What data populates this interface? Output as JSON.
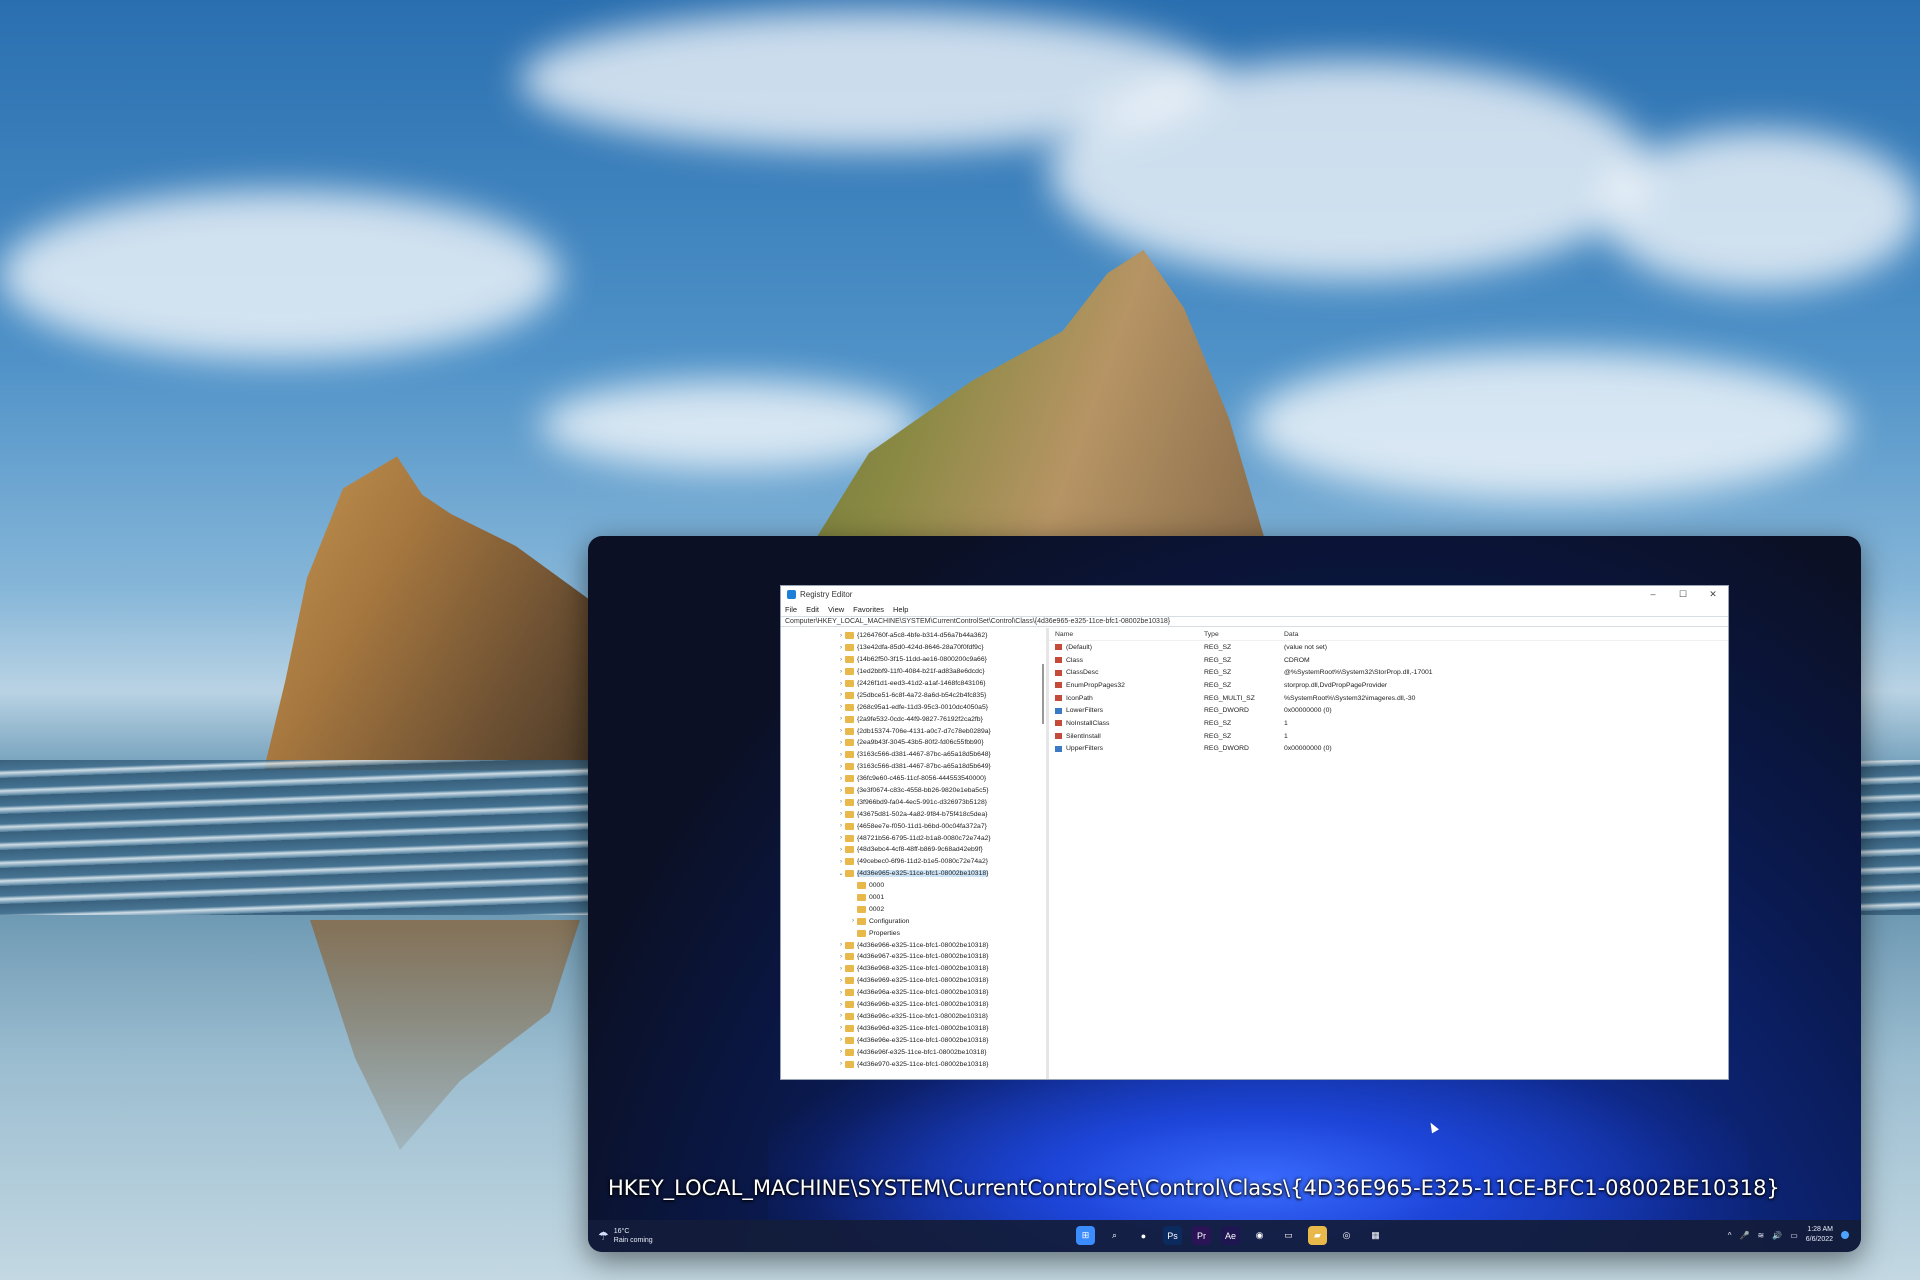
{
  "regedit": {
    "title": "Registry Editor",
    "controls": {
      "minimize": "–",
      "maximize": "☐",
      "close": "✕"
    },
    "menu": [
      "File",
      "Edit",
      "View",
      "Favorites",
      "Help"
    ],
    "address": "Computer\\HKEY_LOCAL_MACHINE\\SYSTEM\\CurrentControlSet\\Control\\Class\\{4d36e965-e325-11ce-bfc1-08002be10318}",
    "tree": [
      {
        "label": "{1264760f-a5c8-4bfe-b314-d56a7b44a362}",
        "level": 0,
        "expanded": false,
        "selected": false
      },
      {
        "label": "{13e42dfa-85d0-424d-8646-28a70f0fdf9c}",
        "level": 0,
        "expanded": false,
        "selected": false
      },
      {
        "label": "{14b62f50-3f15-11dd-ae16-0800200c9a66}",
        "level": 0,
        "expanded": false,
        "selected": false
      },
      {
        "label": "{1ed2bbf9-11f0-4084-b21f-ad83a8e6dcdc}",
        "level": 0,
        "expanded": false,
        "selected": false
      },
      {
        "label": "{2426f1d1-eed3-41d2-a1af-1468fc843106}",
        "level": 0,
        "expanded": false,
        "selected": false
      },
      {
        "label": "{25dbce51-6c8f-4a72-8a6d-b54c2b4fc835}",
        "level": 0,
        "expanded": false,
        "selected": false
      },
      {
        "label": "{268c95a1-edfe-11d3-95c3-0010dc4050a5}",
        "level": 0,
        "expanded": false,
        "selected": false
      },
      {
        "label": "{2a9fe532-0cdc-44f9-9827-76192f2ca2fb}",
        "level": 0,
        "expanded": false,
        "selected": false
      },
      {
        "label": "{2db15374-706e-4131-a0c7-d7c78eb0289a}",
        "level": 0,
        "expanded": false,
        "selected": false
      },
      {
        "label": "{2ea9b43f-3045-43b5-80f2-fd06c55fbb90}",
        "level": 0,
        "expanded": false,
        "selected": false
      },
      {
        "label": "{3163c566-d381-4467-87bc-a65a18d5b648}",
        "level": 0,
        "expanded": false,
        "selected": false
      },
      {
        "label": "{3163c566-d381-4467-87bc-a65a18d5b649}",
        "level": 0,
        "expanded": false,
        "selected": false
      },
      {
        "label": "{36fc9e60-c465-11cf-8056-444553540000}",
        "level": 0,
        "expanded": false,
        "selected": false
      },
      {
        "label": "{3e3f0674-c83c-4558-bb26-9820e1eba5c5}",
        "level": 0,
        "expanded": false,
        "selected": false
      },
      {
        "label": "{3f966bd9-fa04-4ec5-991c-d326973b5128}",
        "level": 0,
        "expanded": false,
        "selected": false
      },
      {
        "label": "{43675d81-502a-4a82-9f84-b75f418c5dea}",
        "level": 0,
        "expanded": false,
        "selected": false
      },
      {
        "label": "{4658ee7e-f050-11d1-b6bd-00c04fa372a7}",
        "level": 0,
        "expanded": false,
        "selected": false
      },
      {
        "label": "{48721b56-6795-11d2-b1a8-0080c72e74a2}",
        "level": 0,
        "expanded": false,
        "selected": false
      },
      {
        "label": "{48d3ebc4-4cf8-48ff-b869-9c68ad42eb9f}",
        "level": 0,
        "expanded": false,
        "selected": false
      },
      {
        "label": "{49cebec0-6f96-11d2-b1e5-0080c72e74a2}",
        "level": 0,
        "expanded": false,
        "selected": false
      },
      {
        "label": "{4d36e965-e325-11ce-bfc1-08002be10318}",
        "level": 0,
        "expanded": true,
        "selected": true
      },
      {
        "label": "0000",
        "level": 1,
        "expanded": false,
        "selected": false
      },
      {
        "label": "0001",
        "level": 1,
        "expanded": false,
        "selected": false
      },
      {
        "label": "0002",
        "level": 1,
        "expanded": false,
        "selected": false
      },
      {
        "label": "Configuration",
        "level": 1,
        "expanded": false,
        "selected": false
      },
      {
        "label": "Properties",
        "level": 1,
        "expanded": false,
        "selected": false
      },
      {
        "label": "{4d36e966-e325-11ce-bfc1-08002be10318}",
        "level": 0,
        "expanded": false,
        "selected": false
      },
      {
        "label": "{4d36e967-e325-11ce-bfc1-08002be10318}",
        "level": 0,
        "expanded": false,
        "selected": false
      },
      {
        "label": "{4d36e968-e325-11ce-bfc1-08002be10318}",
        "level": 0,
        "expanded": false,
        "selected": false
      },
      {
        "label": "{4d36e969-e325-11ce-bfc1-08002be10318}",
        "level": 0,
        "expanded": false,
        "selected": false
      },
      {
        "label": "{4d36e96a-e325-11ce-bfc1-08002be10318}",
        "level": 0,
        "expanded": false,
        "selected": false
      },
      {
        "label": "{4d36e96b-e325-11ce-bfc1-08002be10318}",
        "level": 0,
        "expanded": false,
        "selected": false
      },
      {
        "label": "{4d36e96c-e325-11ce-bfc1-08002be10318}",
        "level": 0,
        "expanded": false,
        "selected": false
      },
      {
        "label": "{4d36e96d-e325-11ce-bfc1-08002be10318}",
        "level": 0,
        "expanded": false,
        "selected": false
      },
      {
        "label": "{4d36e96e-e325-11ce-bfc1-08002be10318}",
        "level": 0,
        "expanded": false,
        "selected": false
      },
      {
        "label": "{4d36e96f-e325-11ce-bfc1-08002be10318}",
        "level": 0,
        "expanded": false,
        "selected": false
      },
      {
        "label": "{4d36e970-e325-11ce-bfc1-08002be10318}",
        "level": 0,
        "expanded": false,
        "selected": false
      }
    ],
    "columns": {
      "name": "Name",
      "type": "Type",
      "data": "Data"
    },
    "values": [
      {
        "name": "(Default)",
        "type": "REG_SZ",
        "data": "(value not set)",
        "kind": "ab"
      },
      {
        "name": "Class",
        "type": "REG_SZ",
        "data": "CDROM",
        "kind": "ab"
      },
      {
        "name": "ClassDesc",
        "type": "REG_SZ",
        "data": "@%SystemRoot%\\System32\\StorProp.dll,-17001",
        "kind": "ab"
      },
      {
        "name": "EnumPropPages32",
        "type": "REG_SZ",
        "data": "storprop.dll,DvdPropPageProvider",
        "kind": "ab"
      },
      {
        "name": "IconPath",
        "type": "REG_MULTI_SZ",
        "data": "%SystemRoot%\\System32\\imageres.dll,-30",
        "kind": "ab"
      },
      {
        "name": "LowerFilters",
        "type": "REG_DWORD",
        "data": "0x00000000 (0)",
        "kind": "bin"
      },
      {
        "name": "NoInstallClass",
        "type": "REG_SZ",
        "data": "1",
        "kind": "ab"
      },
      {
        "name": "SilentInstall",
        "type": "REG_SZ",
        "data": "1",
        "kind": "ab"
      },
      {
        "name": "UpperFilters",
        "type": "REG_DWORD",
        "data": "0x00000000 (0)",
        "kind": "bin"
      }
    ]
  },
  "caption": "HKEY_LOCAL_MACHINE\\SYSTEM\\CurrentControlSet\\Control\\Class\\{4D36E965-E325-11CE-BFC1-08002BE10318}",
  "taskbar": {
    "weather_temp": "16°C",
    "weather_desc": "Rain coming",
    "weather_icon": "rain-cloud-icon",
    "apps": [
      {
        "name": "start-icon",
        "glyph": "⊞",
        "color": "#3b8cff"
      },
      {
        "name": "search-icon",
        "glyph": "⌕",
        "color": "transparent"
      },
      {
        "name": "chat-icon",
        "glyph": "●",
        "color": "transparent"
      },
      {
        "name": "photoshop-icon",
        "glyph": "Ps",
        "color": "#0b2a5e"
      },
      {
        "name": "premiere-icon",
        "glyph": "Pr",
        "color": "#2a1456"
      },
      {
        "name": "after-effects-icon",
        "glyph": "Ae",
        "color": "#1e1650"
      },
      {
        "name": "chrome-icon",
        "glyph": "◉",
        "color": "transparent"
      },
      {
        "name": "terminal-icon",
        "glyph": "▭",
        "color": "transparent"
      },
      {
        "name": "file-explorer-icon",
        "glyph": "▰",
        "color": "#e8b94a"
      },
      {
        "name": "firefox-icon",
        "glyph": "◎",
        "color": "transparent"
      },
      {
        "name": "regedit-icon",
        "glyph": "▦",
        "color": "transparent"
      }
    ],
    "tray": {
      "chevron": "^",
      "mic": "🎤",
      "wifi": "≋",
      "volume": "🔊",
      "battery": "▭"
    },
    "time": "1:28 AM",
    "date": "6/6/2022"
  }
}
